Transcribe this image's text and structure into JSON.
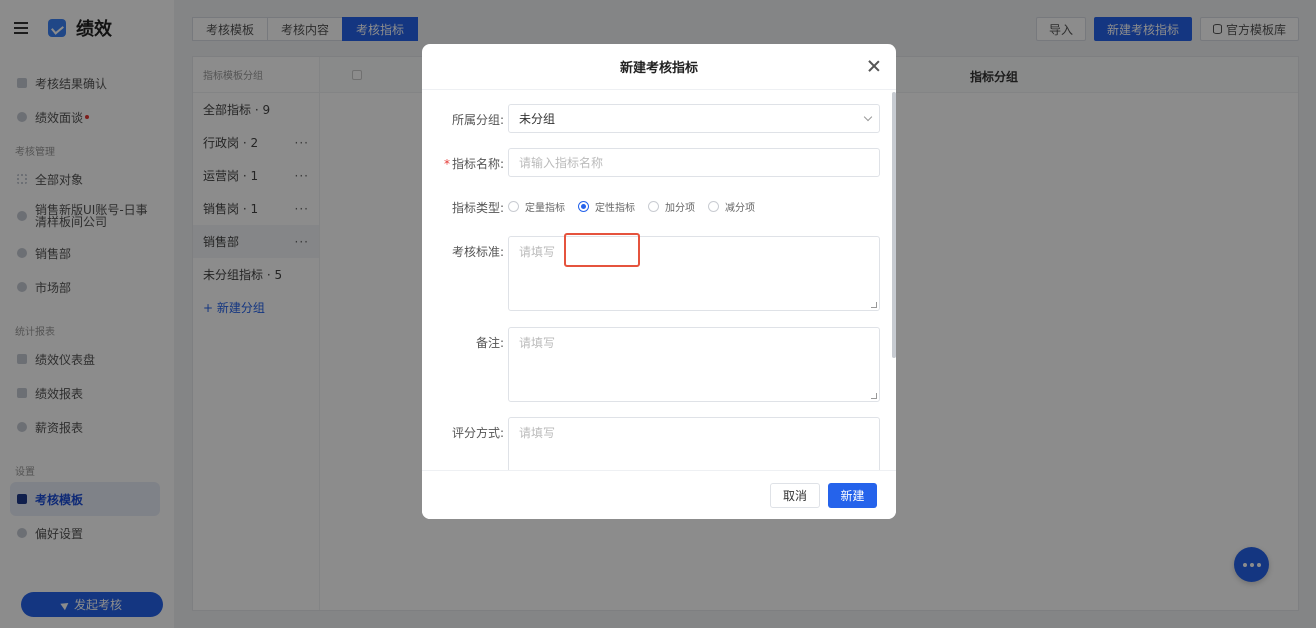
{
  "app": {
    "title": "绩效"
  },
  "sidebar": {
    "items_top": [
      {
        "label": "考核结果确认",
        "icon": "user-check-icon"
      },
      {
        "label": "绩效面谈",
        "icon": "chat-icon",
        "badge_dot": true
      }
    ],
    "group_mgmt": "考核管理",
    "items_mgmt": [
      {
        "label": "全部对象",
        "icon": "grid-icon"
      },
      {
        "label": "销售新版UI账号-日事清样板间公司",
        "icon": "org-icon"
      },
      {
        "label": "销售部",
        "icon": "org-icon"
      },
      {
        "label": "市场部",
        "icon": "org-icon"
      }
    ],
    "group_stats": "统计报表",
    "items_stats": [
      {
        "label": "绩效仪表盘",
        "icon": "dashboard-icon"
      },
      {
        "label": "绩效报表",
        "icon": "report-icon"
      },
      {
        "label": "薪资报表",
        "icon": "salary-icon"
      }
    ],
    "group_settings": "设置",
    "items_settings": [
      {
        "label": "考核模板",
        "icon": "template-icon",
        "active": true
      },
      {
        "label": "偏好设置",
        "icon": "settings-icon"
      }
    ],
    "launch_button": "发起考核"
  },
  "tabs": [
    {
      "label": "考核模板"
    },
    {
      "label": "考核内容"
    },
    {
      "label": "考核指标",
      "active": true
    }
  ],
  "toolbar": {
    "import_label": "导入",
    "new_indicator_label": "新建考核指标",
    "official_lib_label": "官方模板库"
  },
  "groups_panel": {
    "header": "指标模板分组",
    "items": [
      {
        "label": "全部指标 · 9"
      },
      {
        "label": "行政岗 · 2",
        "more": "···"
      },
      {
        "label": "运营岗 · 1",
        "more": "···"
      },
      {
        "label": "销售岗 · 1",
        "more": "···"
      },
      {
        "label": "销售部",
        "more": "···",
        "selected": true
      },
      {
        "label": "未分组指标 · 5"
      }
    ],
    "add_label": "+ 新建分组"
  },
  "table": {
    "col_group": "指标分组"
  },
  "modal": {
    "title": "新建考核指标",
    "group_label": "所属分组:",
    "group_value": "未分组",
    "name_label": "指标名称:",
    "name_required": "*",
    "name_placeholder": "请输入指标名称",
    "type_label": "指标类型:",
    "type_options": [
      {
        "label": "定量指标",
        "checked": false
      },
      {
        "label": "定性指标",
        "checked": true
      },
      {
        "label": "加分项",
        "checked": false
      },
      {
        "label": "减分项",
        "checked": false
      }
    ],
    "standard_label": "考核标准:",
    "standard_placeholder": "请填写",
    "remark_label": "备注:",
    "remark_placeholder": "请填写",
    "scoring_label": "评分方式:",
    "scoring_placeholder": "请填写",
    "cancel_label": "取消",
    "create_label": "新建"
  }
}
